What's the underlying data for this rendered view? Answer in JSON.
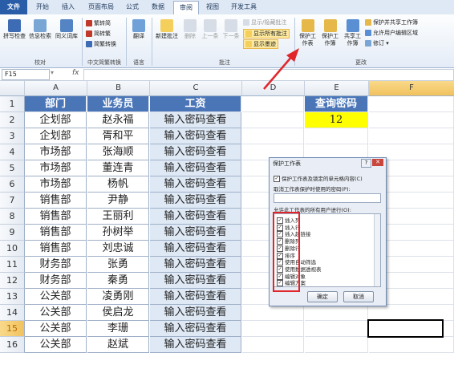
{
  "tabs": [
    "文件",
    "开始",
    "插入",
    "页面布局",
    "公式",
    "数据",
    "审阅",
    "视图",
    "开发工具"
  ],
  "active_tab": "审阅",
  "ribbon": {
    "proofing": {
      "spell": "拼写检查",
      "research": "信息检索",
      "thesaurus": "同义词库",
      "label": "校对"
    },
    "chinese": {
      "to_trad": "繁转简",
      "to_simp": "简转繁",
      "convert": "简繁转换",
      "label": "中文简繁转换"
    },
    "language": {
      "translate": "翻译",
      "label": "语言"
    },
    "comments": {
      "new": "新建批注",
      "delete": "删除",
      "prev": "上一条",
      "next": "下一条",
      "show_hide": "显示/隐藏批注",
      "show_all": "显示所有批注",
      "show_ink": "显示墨迹",
      "label": "批注"
    },
    "changes": {
      "protect_sheet": "保护工作表",
      "protect_book": "保护工作簿",
      "share_book": "共享工作簿",
      "protect_share": "保护并共享工作簿",
      "allow_edit": "允许用户编辑区域",
      "track": "修订",
      "label": "更改"
    }
  },
  "namebox": "F15",
  "fx": "fx",
  "columns": [
    "A",
    "B",
    "C",
    "D",
    "E",
    "F"
  ],
  "rows": [
    "1",
    "2",
    "3",
    "4",
    "5",
    "6",
    "7",
    "8",
    "9",
    "10",
    "11",
    "12",
    "13",
    "14",
    "15",
    "16"
  ],
  "table": {
    "headers": [
      "部门",
      "业务员",
      "工资"
    ],
    "data": [
      [
        "企划部",
        "赵永福",
        "输入密码查看"
      ],
      [
        "企划部",
        "胥和平",
        "输入密码查看"
      ],
      [
        "市场部",
        "张海顺",
        "输入密码查看"
      ],
      [
        "市场部",
        "董连青",
        "输入密码查看"
      ],
      [
        "市场部",
        "杨帆",
        "输入密码查看"
      ],
      [
        "销售部",
        "尹静",
        "输入密码查看"
      ],
      [
        "销售部",
        "王丽利",
        "输入密码查看"
      ],
      [
        "销售部",
        "孙树举",
        "输入密码查看"
      ],
      [
        "销售部",
        "刘忠诚",
        "输入密码查看"
      ],
      [
        "财务部",
        "张勇",
        "输入密码查看"
      ],
      [
        "财务部",
        "秦勇",
        "输入密码查看"
      ],
      [
        "公关部",
        "凌勇刚",
        "输入密码查看"
      ],
      [
        "公关部",
        "侯启龙",
        "输入密码查看"
      ],
      [
        "公关部",
        "李珊",
        "输入密码查看"
      ],
      [
        "公关部",
        "赵斌",
        "输入密码查看"
      ]
    ]
  },
  "query": {
    "label": "查询密码",
    "value": "12"
  },
  "dialog": {
    "title": "保护工作表",
    "protect_contents": "保护工作表及锁定的单元格内容(C)",
    "password_label": "取消工作表保护时使用的密码(P):",
    "allow_label": "允许此工作表的所有用户进行(O):",
    "options": [
      "插入列",
      "插入行",
      "插入超链接",
      "删除列",
      "删除行",
      "排序",
      "使用自动筛选",
      "使用数据透视表",
      "编辑对象",
      "编辑方案"
    ],
    "ok": "确定",
    "cancel": "取消"
  },
  "colors": {
    "header_fill": "#4a76b8",
    "query_fill": "#ffff00",
    "accent_red": "#e0262b"
  }
}
